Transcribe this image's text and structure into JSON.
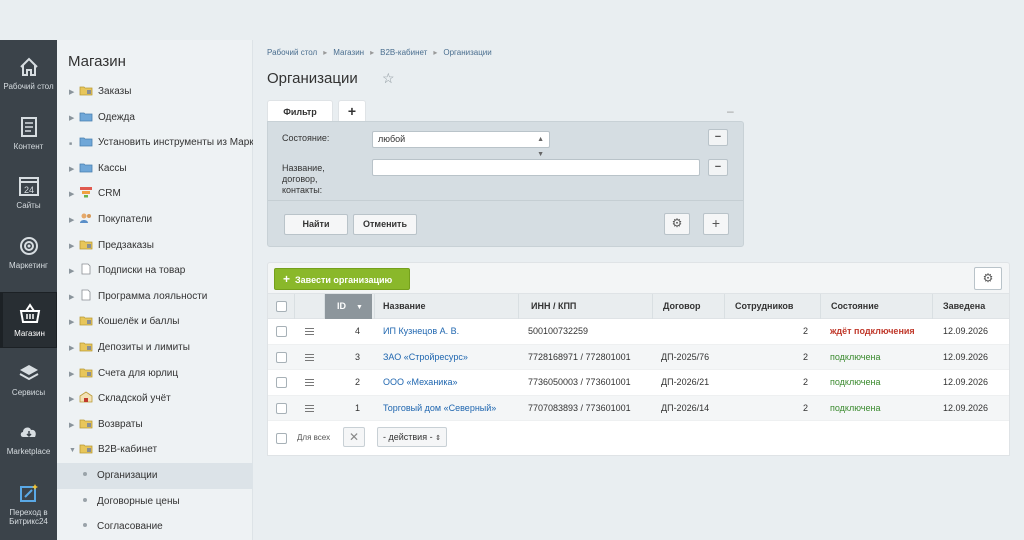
{
  "leftbar": {
    "items": [
      {
        "label": "Рабочий стол",
        "icon": "home-icon"
      },
      {
        "label": "Контент",
        "icon": "document-icon"
      },
      {
        "label": "Сайты",
        "icon": "calendar-icon",
        "badge": "24"
      },
      {
        "label": "Маркетинг",
        "icon": "target-icon"
      },
      {
        "label": "Магазин",
        "icon": "basket-icon"
      },
      {
        "label": "Сервисы",
        "icon": "layers-icon"
      },
      {
        "label": "Marketplace",
        "icon": "cloud-download-icon"
      },
      {
        "label": "Переход в Битрикс24",
        "icon": "magic-wand-icon"
      }
    ]
  },
  "menu": {
    "title": "Магазин",
    "items": [
      {
        "label": "Заказы"
      },
      {
        "label": "Одежда"
      },
      {
        "label": "Установить инструменты из Маркетплейс"
      },
      {
        "label": "Кассы"
      },
      {
        "label": "CRM"
      },
      {
        "label": "Покупатели"
      },
      {
        "label": "Предзаказы"
      },
      {
        "label": "Подписки на товар"
      },
      {
        "label": "Программа лояльности"
      },
      {
        "label": "Кошелёк и баллы"
      },
      {
        "label": "Депозиты и лимиты"
      },
      {
        "label": "Счета для юрлиц"
      },
      {
        "label": "Складской учёт"
      },
      {
        "label": "Возвраты"
      },
      {
        "label": "B2B-кабинет"
      }
    ],
    "subitems": [
      {
        "label": "Организации"
      },
      {
        "label": "Договорные цены"
      },
      {
        "label": "Согласование"
      }
    ]
  },
  "breadcrumbs": [
    "Рабочий стол",
    "Магазин",
    "B2B-кабинет",
    "Организации"
  ],
  "page": {
    "title": "Организации"
  },
  "filter": {
    "tab_label": "Фильтр",
    "add_tab": "+",
    "minimize": "–",
    "state_label": "Состояние:",
    "state_value": "любой",
    "name_label": "Название,\nдоговор,\nконтакты:",
    "name_value": "",
    "find_button": "Найти",
    "cancel_button": "Отменить",
    "minus": "−",
    "plus": "+"
  },
  "toolbar": {
    "add_label": "Завести организацию"
  },
  "grid": {
    "columns": [
      "ID",
      "Название",
      "ИНН / КПП",
      "Договор",
      "Сотрудников",
      "Состояние",
      "Заведена"
    ],
    "rows": [
      {
        "id": "4",
        "name": "ИП Кузнецов А. В.",
        "inn": "500100732259",
        "contract": "",
        "employees": "2",
        "status": "ждёт подключения",
        "status_color": "#c0392b",
        "date": "12.09.2026"
      },
      {
        "id": "3",
        "name": "ЗАО «Стройресурс»",
        "inn": "7728168971 / 772801001",
        "contract": "ДП-2025/76",
        "employees": "2",
        "status": "подключена",
        "status_color": "#3a8a2e",
        "date": "12.09.2026"
      },
      {
        "id": "2",
        "name": "ООО «Механика»",
        "inn": "7736050003 / 773601001",
        "contract": "ДП-2026/21",
        "employees": "2",
        "status": "подключена",
        "status_color": "#3a8a2e",
        "date": "12.09.2026"
      },
      {
        "id": "1",
        "name": "Торговый дом «Северный»",
        "inn": "7707083893 / 773601001",
        "contract": "ДП-2026/14",
        "employees": "2",
        "status": "подключена",
        "status_color": "#3a8a2e",
        "date": "12.09.2026"
      }
    ],
    "footer": {
      "select_all": "Для всех",
      "actions": "- действия -"
    }
  }
}
